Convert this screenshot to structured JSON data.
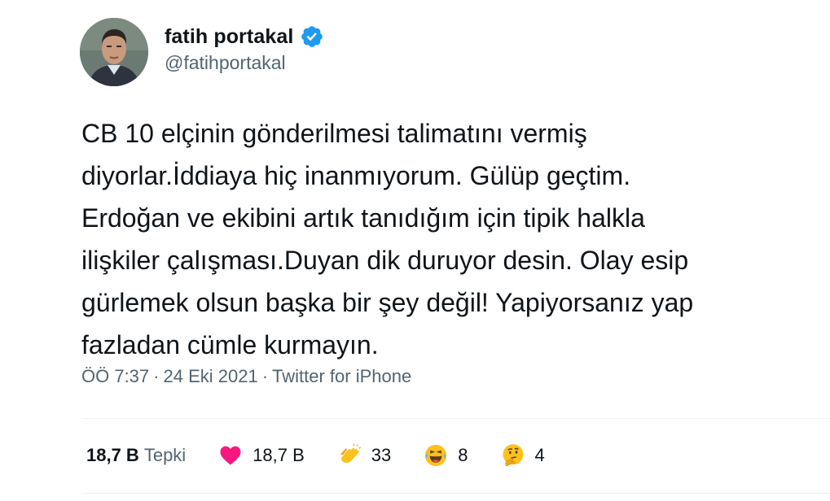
{
  "author": {
    "display_name": "fatih portakal",
    "handle": "@fatihportakal",
    "verified": true,
    "avatar_icon": "avatar-photo",
    "verified_icon": "verified-badge-icon",
    "verified_color": "#1d9bf0"
  },
  "tweet": {
    "lines": [
      "CB 10 elçinin gönderilmesi talimatını vermiş",
      "diyorlar.İddiaya hiç inanmıyorum. Gülüp geçtim.",
      "Erdoğan ve ekibini artık tanıdığım için tipik halkla",
      "ilişkiler çalışması.Duyan dik duruyor desin. Olay esip",
      "gürlemek olsun başka bir şey değil! Yapiyorsanız yap",
      "fazladan cümle kurmayın."
    ]
  },
  "meta": {
    "time": "ÖÖ 7:37",
    "separator": "·",
    "date": "24 Eki 2021",
    "source": "Twitter for iPhone"
  },
  "reactions": {
    "total_count": "18,7 B",
    "total_label": "Tepki",
    "items": [
      {
        "icon": "heart-icon",
        "color": "#f91880",
        "count": "18,7 B"
      },
      {
        "icon": "clap-icon",
        "color": "#fcc21b",
        "count": "33"
      },
      {
        "icon": "laughing-face-icon",
        "color": "#fcc21b",
        "count": "8"
      },
      {
        "icon": "thinking-face-icon",
        "color": "#fcc21b",
        "count": "4"
      }
    ]
  }
}
